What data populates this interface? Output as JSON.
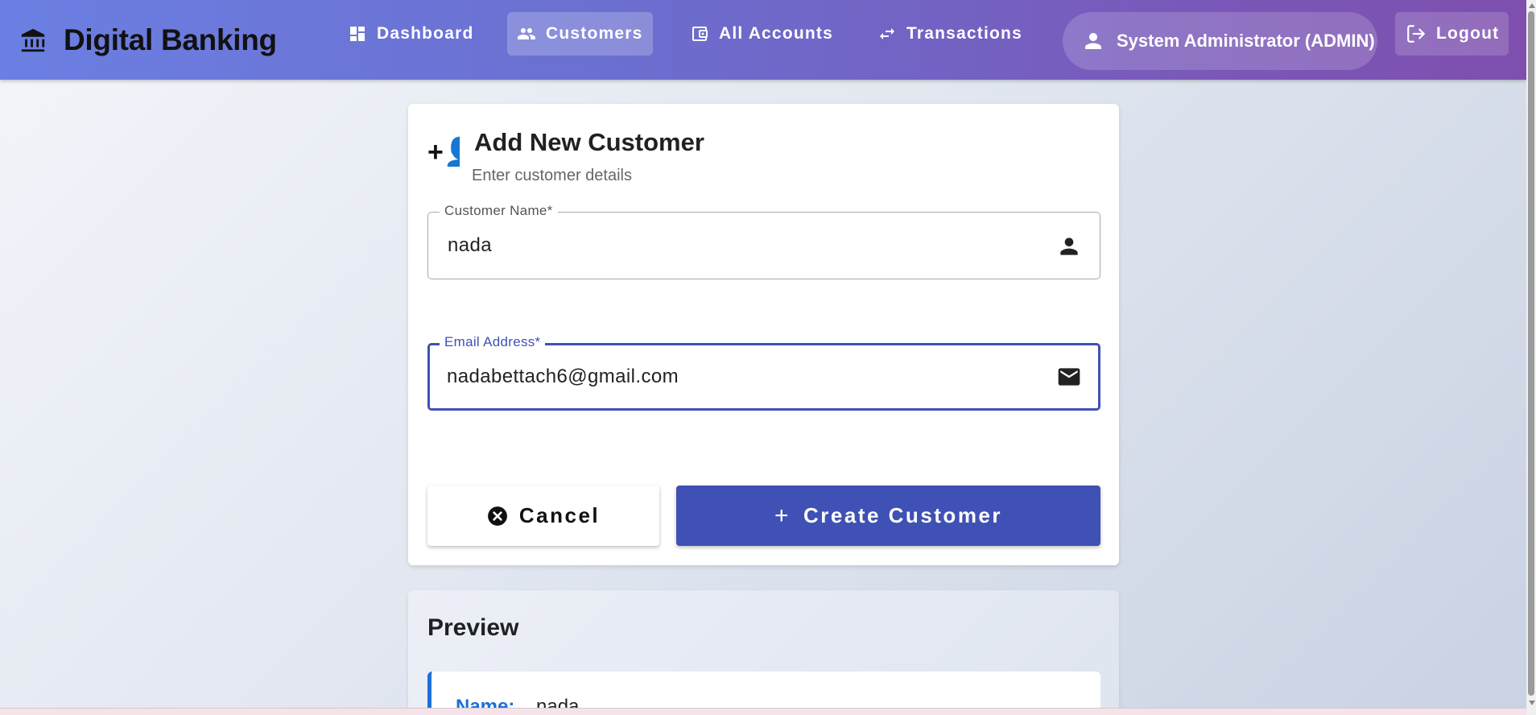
{
  "app": {
    "brand": "Digital Banking"
  },
  "nav": {
    "items": [
      {
        "label": "Dashboard",
        "icon": "dashboard-icon"
      },
      {
        "label": "Customers",
        "icon": "people-icon",
        "active": true
      },
      {
        "label": "All Accounts",
        "icon": "wallet-icon"
      },
      {
        "label": "Transactions",
        "icon": "swap-arrows-icon"
      }
    ],
    "user": "System Administrator (ADMIN)",
    "logout": "Logout"
  },
  "form": {
    "icon_text": "+👤",
    "title": "Add New Customer",
    "subtitle": "Enter customer details",
    "name_field": {
      "label": "Customer Name*",
      "value": "nada"
    },
    "email_field": {
      "label": "Email Address*",
      "value": "nadabettach6@gmail.com",
      "focused": true
    },
    "cancel_label": "Cancel",
    "create_plus": "+",
    "create_label": "Create Customer"
  },
  "preview": {
    "title": "Preview",
    "name_key": "Name:",
    "name_value": "nada"
  },
  "colors": {
    "primary": "#3f51b5",
    "header_start": "#6b7fe2",
    "header_end": "#7e4fae",
    "preview_accent": "#1e6fd9"
  }
}
